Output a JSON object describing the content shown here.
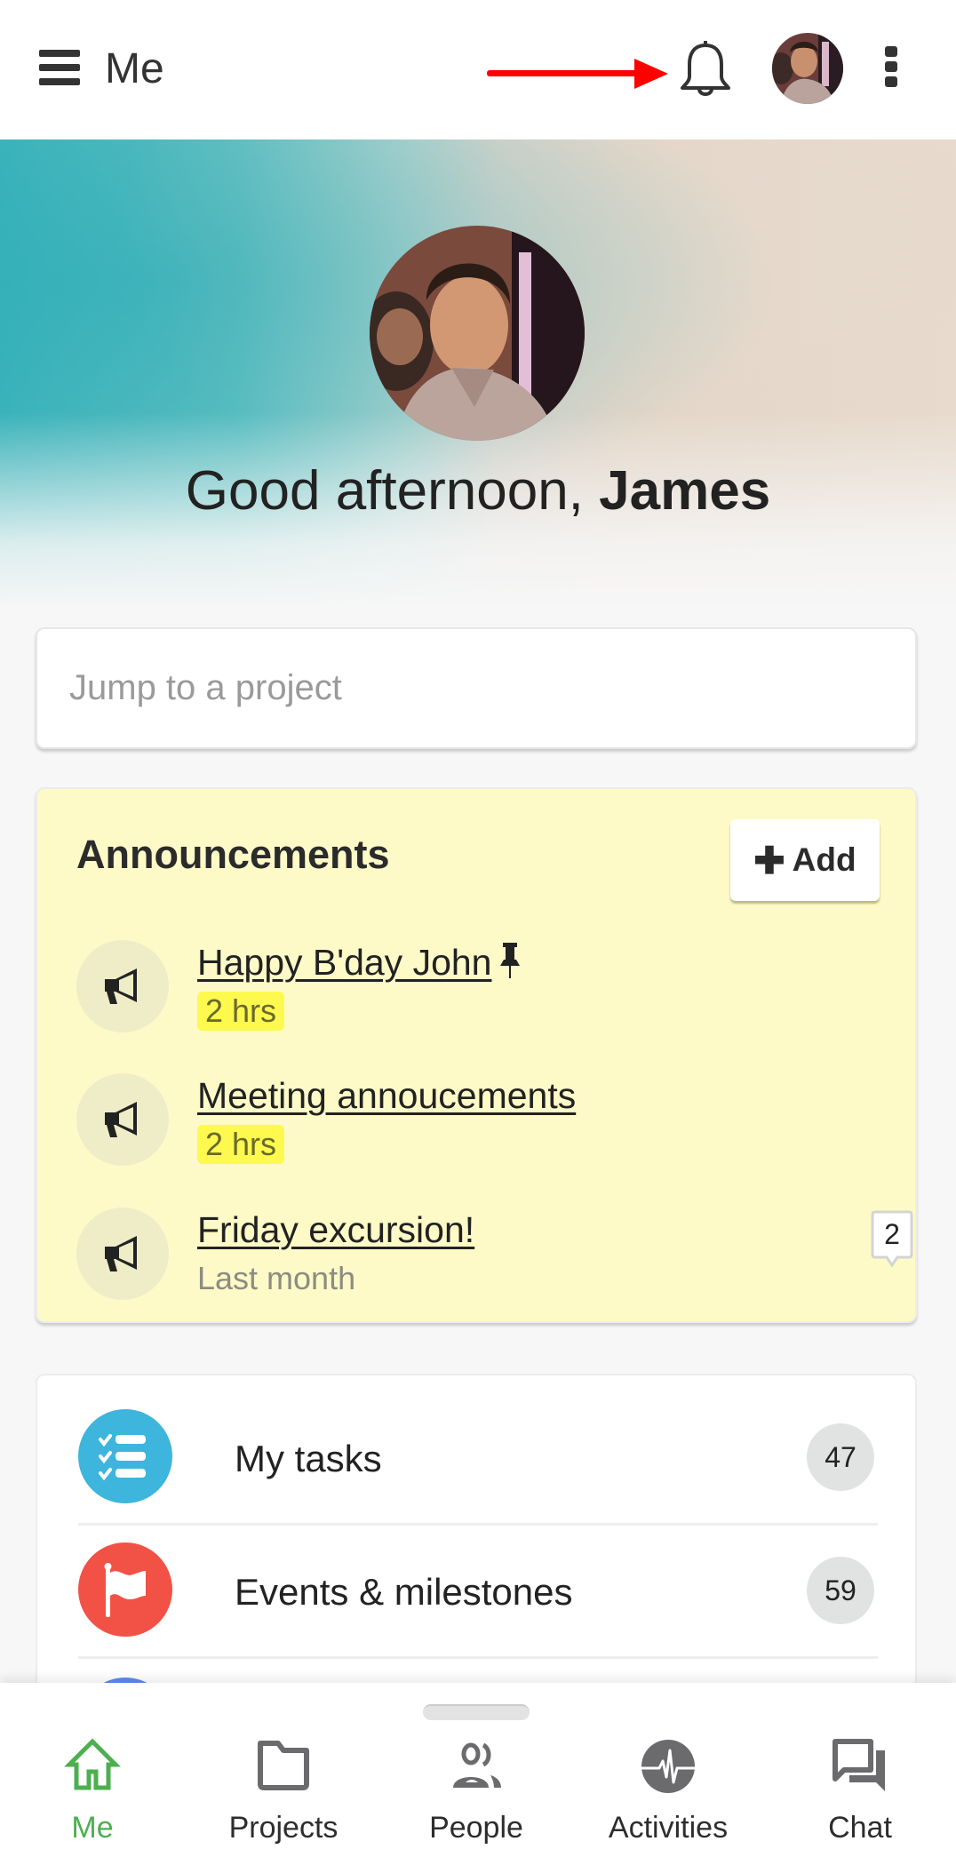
{
  "header": {
    "title": "Me",
    "menu_icon": "hamburger-menu-icon",
    "notification_icon": "bell-icon",
    "more_icon": "more-vertical-icon",
    "annotation": "red-arrow-pointing-to-bell"
  },
  "hero": {
    "greeting_prefix": "Good afternoon, ",
    "user_name": "James"
  },
  "search": {
    "placeholder": "Jump to a project",
    "value": ""
  },
  "announcements": {
    "title": "Announcements",
    "add_label": "Add",
    "items": [
      {
        "title": "Happy B'day John",
        "time": "2 hrs",
        "pinned": true,
        "highlight_time": true
      },
      {
        "title": "Meeting annoucements",
        "time": "2 hrs",
        "pinned": false,
        "highlight_time": true
      },
      {
        "title": "Friday excursion!",
        "time": "Last month",
        "pinned": false,
        "highlight_time": false,
        "comments": "2"
      }
    ]
  },
  "tasks": {
    "items": [
      {
        "label": "My tasks",
        "count": "47",
        "icon": "checklist-icon",
        "color": "#3db5dc"
      },
      {
        "label": "Events & milestones",
        "count": "59",
        "icon": "flag-icon",
        "color": "#f25146"
      }
    ]
  },
  "bottom_nav": {
    "items": [
      {
        "label": "Me",
        "icon": "home-icon",
        "active": true
      },
      {
        "label": "Projects",
        "icon": "folder-icon",
        "active": false
      },
      {
        "label": "People",
        "icon": "people-icon",
        "active": false
      },
      {
        "label": "Activities",
        "icon": "pulse-icon",
        "active": false
      },
      {
        "label": "Chat",
        "icon": "chat-icon",
        "active": false
      }
    ]
  },
  "colors": {
    "accent_green": "#4caf50",
    "announcement_bg": "#fdfac7",
    "time_highlight": "#fdf94e",
    "annotation_red": "#ff0000"
  }
}
